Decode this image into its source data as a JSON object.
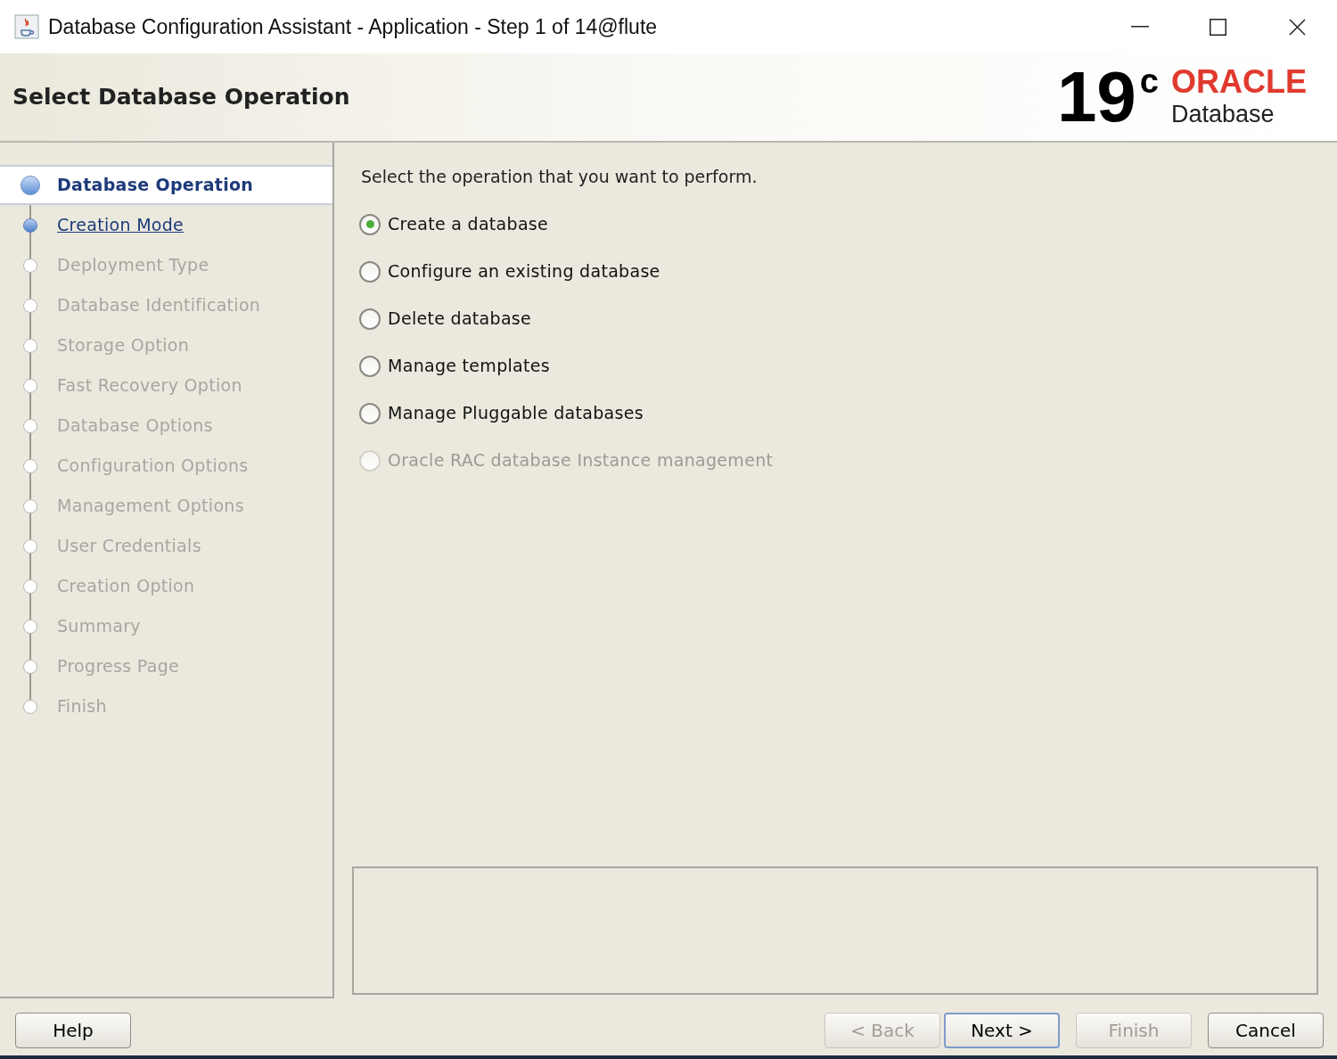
{
  "window": {
    "title": "Database Configuration Assistant - Application - Step 1 of 14@flute"
  },
  "header": {
    "title": "Select Database Operation",
    "logo": {
      "version": "19",
      "suffix": "c",
      "brand": "ORACLE",
      "product": "Database"
    }
  },
  "steps": [
    {
      "label": "Database Operation",
      "selected": true,
      "enabled": true
    },
    {
      "label": "Creation Mode",
      "selected": false,
      "enabled": true
    },
    {
      "label": "Deployment Type",
      "selected": false,
      "enabled": false
    },
    {
      "label": "Database Identification",
      "selected": false,
      "enabled": false
    },
    {
      "label": "Storage Option",
      "selected": false,
      "enabled": false
    },
    {
      "label": "Fast Recovery Option",
      "selected": false,
      "enabled": false
    },
    {
      "label": "Database Options",
      "selected": false,
      "enabled": false
    },
    {
      "label": "Configuration Options",
      "selected": false,
      "enabled": false
    },
    {
      "label": "Management Options",
      "selected": false,
      "enabled": false
    },
    {
      "label": "User Credentials",
      "selected": false,
      "enabled": false
    },
    {
      "label": "Creation Option",
      "selected": false,
      "enabled": false
    },
    {
      "label": "Summary",
      "selected": false,
      "enabled": false
    },
    {
      "label": "Progress Page",
      "selected": false,
      "enabled": false
    },
    {
      "label": "Finish",
      "selected": false,
      "enabled": false
    }
  ],
  "prompt": "Select the operation that you want to perform.",
  "options": [
    {
      "label": "Create a database",
      "selected": true,
      "disabled": false
    },
    {
      "label": "Configure an existing database",
      "selected": false,
      "disabled": false
    },
    {
      "label": "Delete database",
      "selected": false,
      "disabled": false
    },
    {
      "label": "Manage templates",
      "selected": false,
      "disabled": false
    },
    {
      "label": "Manage Pluggable databases",
      "selected": false,
      "disabled": false
    },
    {
      "label": "Oracle RAC database Instance management",
      "selected": false,
      "disabled": true
    }
  ],
  "buttons": {
    "help": {
      "label": "Help",
      "disabled": false,
      "default": false
    },
    "nav": [
      {
        "label": "< Back",
        "disabled": true,
        "default": false
      },
      {
        "label": "Next >",
        "disabled": false,
        "default": true
      },
      {
        "label": "Finish",
        "disabled": true,
        "default": false
      },
      {
        "label": "Cancel",
        "disabled": false,
        "default": false
      }
    ]
  }
}
